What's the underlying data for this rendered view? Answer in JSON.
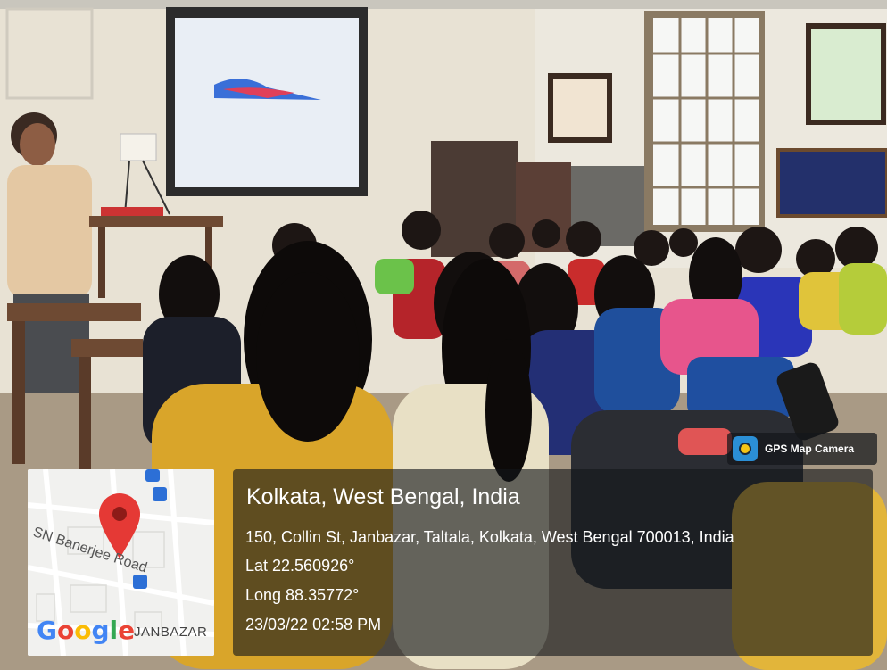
{
  "overlay": {
    "app_badge": "GPS Map Camera",
    "location_title": "Kolkata, West Bengal, India",
    "address": "150, Collin St, Janbazar, Taltala, Kolkata, West Bengal 700013, India",
    "latitude": "Lat 22.560926°",
    "longitude": "Long 88.35772°",
    "timestamp": "23/03/22 02:58 PM"
  },
  "map": {
    "road_label": "SN Banerjee Road",
    "area_label": "JANBAZAR",
    "provider_logo": "Google",
    "marker_color": "#e53935"
  },
  "scene": {
    "description_icon": "classroom-photo",
    "slide_chart_colors": [
      "#3a6fd8",
      "#e0405a"
    ]
  }
}
